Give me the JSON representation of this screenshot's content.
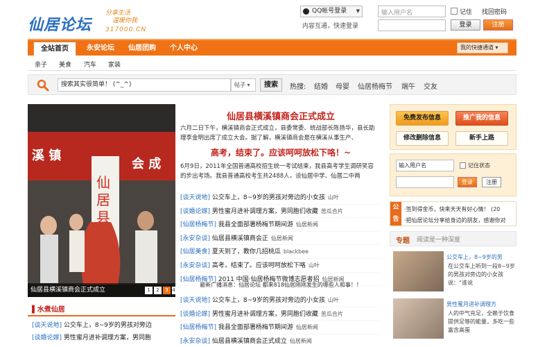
{
  "header": {
    "logo_text": "仙居论坛",
    "slogan_line1": "分享生活",
    "slogan_line2": "温暖你我",
    "domain": "317000.CN",
    "qq_login_label": "QQ帐号登录",
    "qq_sub": "内容互通，快速登录",
    "username_placeholder": "输入用户名",
    "remember_label": "记住",
    "find_password": "找回密码",
    "login_button": "登录",
    "register_button": "注册"
  },
  "nav": {
    "items": [
      "全站首页",
      "永安论坛",
      "仙居团购",
      "个人中心"
    ],
    "active_index": 0,
    "quick_access": "我的快捷通道 ▾"
  },
  "subnav": {
    "items": [
      "亲子",
      "美食",
      "汽车",
      "家装"
    ]
  },
  "search": {
    "query": "搜索其实很简单！ (^_^)",
    "category": "帖子",
    "button": "搜索",
    "hot_label": "热搜:",
    "hot_items": [
      "结婚",
      "母婴",
      "仙居杨梅节",
      "端午",
      "交友"
    ]
  },
  "slideshow": {
    "caption": "仙居县横溪镇商会正式成立",
    "dots": [
      "1",
      "2",
      "3",
      "4"
    ],
    "active_dot": 2
  },
  "headline": {
    "title": "仙居县横溪镇商会正式成立",
    "summary": "六月二日下午，横溪镇商会正式成立，县委常委、统战部长陈扬华，县长助理李金明出席了成立大会。据了解，横溪镇商会是在横溪从事生产、"
  },
  "headline2": {
    "title": "高考，结束了。应该呵呵放松下咯！~",
    "summary": "6月9日，2011年全国普通高校招生统一考试结束，我县高考学生调研笑容的步出考场。我县普通高校考生共2488人，设仙居中学、仙居二中两"
  },
  "news_list": [
    {
      "tag": "[谈天说地]",
      "title": "公交车上，8~9岁的男孩对旁边的小女孩",
      "author": "山叶"
    },
    {
      "tag": "[谈婚论嫁]",
      "title": "男性蜜月进补调理方案，男同胞们收藏",
      "author": "苦瓜合片"
    },
    {
      "tag": "[仙居杨梅节]",
      "title": "我县全面部署杨梅节期间游",
      "author": "仙居新闻"
    },
    {
      "tag": "[永安杂谈]",
      "title": "仙居县横溪镇商会正",
      "author": "仙居新闻"
    },
    {
      "tag": "[仙居美食]",
      "title": "夏天到了，教你几招桃瓜",
      "author": "blackbee"
    },
    {
      "tag": "[永安杂谈]",
      "title": "高考，结束了。应该呵呵放松下咯",
      "author": "山叶"
    },
    {
      "tag": "[仙居杨梅节]",
      "title": "2011 中国·仙居杨梅节微博志愿者招",
      "author": "仙居新闻"
    }
  ],
  "broadcast": "最新广播消息：仙居论坛 都来818仙居刚刚发生的哪些人和事！！",
  "news_list2": [
    {
      "tag": "[谈天说地]",
      "title": "公交车上，8~9岁的男孩对旁边的小女孩",
      "author": "山叶"
    },
    {
      "tag": "[谈婚论嫁]",
      "title": "男性蜜月进补调理方案，男同胞们收藏",
      "author": "苦瓜合片"
    },
    {
      "tag": "[仙居杨梅节]",
      "title": "我县全面部署杨梅节期间游",
      "author": "仙居新闻"
    },
    {
      "tag": "[永安杂谈]",
      "title": "仙居县横溪镇商会正式成立",
      "author": "仙居新闻"
    }
  ],
  "right": {
    "btn_publish": "免费发布信息",
    "btn_promote": "推广我的信息",
    "btn_edit": "修改删除信息",
    "btn_newbie": "新手上路",
    "login_username": "输入用户名",
    "login_remember": "记住状态",
    "login_btn": "登录",
    "reg_btn": "注册",
    "notice_tag": "公告",
    "notice_lines": [
      "·签到得金币，快来天天有好心情！ (20",
      "·把仙居论坛分享给身边的朋友，感谢你对"
    ],
    "topic_title": "专题",
    "topic_sub": "阅读是一种深度",
    "topics": [
      {
        "link": "公交车上，8~9岁的男",
        "text": "在公交车上听到一段8~9岁的男孩对旁边的小女孩说：“谁说"
      },
      {
        "link": "男性蜜月进补调理方",
        "text": "人的中气充足，全赖于饮食提供足够的能量，多吃一些富含高蛋"
      }
    ]
  },
  "bottom_left": {
    "title": "水煮仙居",
    "items": [
      {
        "tag": "[谈天说地]",
        "title": "公交车上，8~9岁的男孩对旁边"
      },
      {
        "tag": "[谈婚论嫁]",
        "title": "男性蜜月进补调理方案，男同胞"
      }
    ]
  }
}
